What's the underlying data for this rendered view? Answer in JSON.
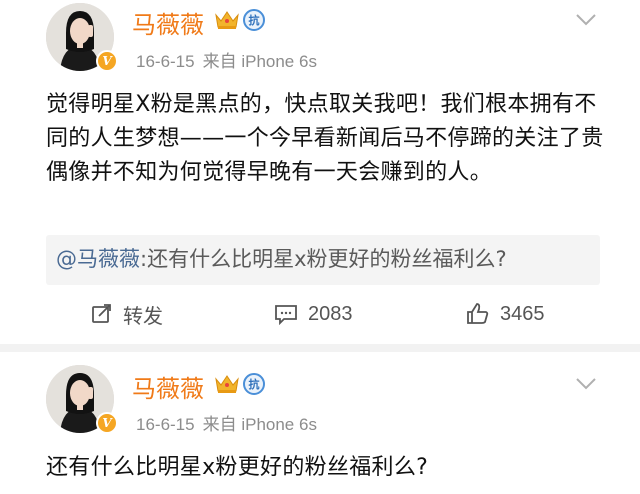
{
  "posts": [
    {
      "user_name": "马薇薇",
      "date": "16-6-15",
      "source": "来自 iPhone 6s",
      "verified_badge": "V",
      "anti_badge": "抗",
      "text": "觉得明星X粉是黑点的，快点取关我吧！我们根本拥有不同的人生梦想——一个今早看新闻后马不停蹄的关注了贵偶像并不知为何觉得早晚有一天会赚到的人。",
      "quoted": {
        "user": "@马薇薇",
        "text": ":还有什么比明星x粉更好的粉丝福利么?"
      },
      "actions": {
        "repost_label": "转发",
        "comment_count": "2083",
        "like_count": "3465"
      }
    },
    {
      "user_name": "马薇薇",
      "date": "16-6-15",
      "source": "来自 iPhone 6s",
      "verified_badge": "V",
      "anti_badge": "抗",
      "text": "还有什么比明星x粉更好的粉丝福利么?"
    }
  ],
  "colors": {
    "username": "#f07a18",
    "meta": "#8c8c8c",
    "quote_bg": "#f4f4f4",
    "link": "#4a6a93",
    "verified": "#f5a623"
  },
  "icons": [
    "avatar",
    "verified-v-icon",
    "crown-icon",
    "anti-badge-icon",
    "chevron-down-icon",
    "repost-icon",
    "comment-icon",
    "like-icon"
  ]
}
